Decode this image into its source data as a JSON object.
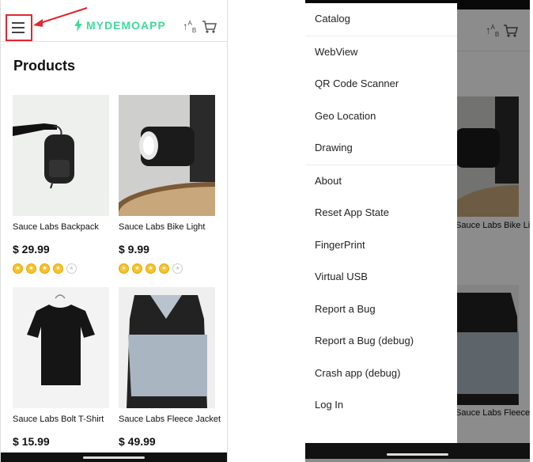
{
  "app": {
    "logo_text": "MYDEMOAPP",
    "brand_color": "#3ddc97",
    "highlight_color": "#e0282e"
  },
  "icons": {
    "menu": "menu-icon",
    "sort": "sort-icon",
    "cart": "cart-icon",
    "logo": "bolt-logo-icon",
    "star": "star-icon"
  },
  "catalog": {
    "title": "Products",
    "products": [
      {
        "name": "Sauce Labs Backpack",
        "price": "$ 29.99",
        "rating": 4
      },
      {
        "name": "Sauce Labs Bike Light",
        "price": "$ 9.99",
        "rating": 4
      },
      {
        "name": "Sauce Labs Bolt T-Shirt",
        "price": "$ 15.99"
      },
      {
        "name": "Sauce Labs Fleece Jacket",
        "price": "$ 49.99"
      }
    ]
  },
  "background": {
    "product_name": "Sauce Labs Bike Light",
    "product_name_2": "Sauce Labs Fleece Jacket"
  },
  "drawer": {
    "items": [
      "Catalog",
      "WebView",
      "QR Code Scanner",
      "Geo Location",
      "Drawing",
      "About",
      "Reset App State",
      "FingerPrint",
      "Virtual USB",
      "Report a Bug",
      "Report a Bug (debug)",
      "Crash app (debug)",
      "Log In"
    ]
  }
}
